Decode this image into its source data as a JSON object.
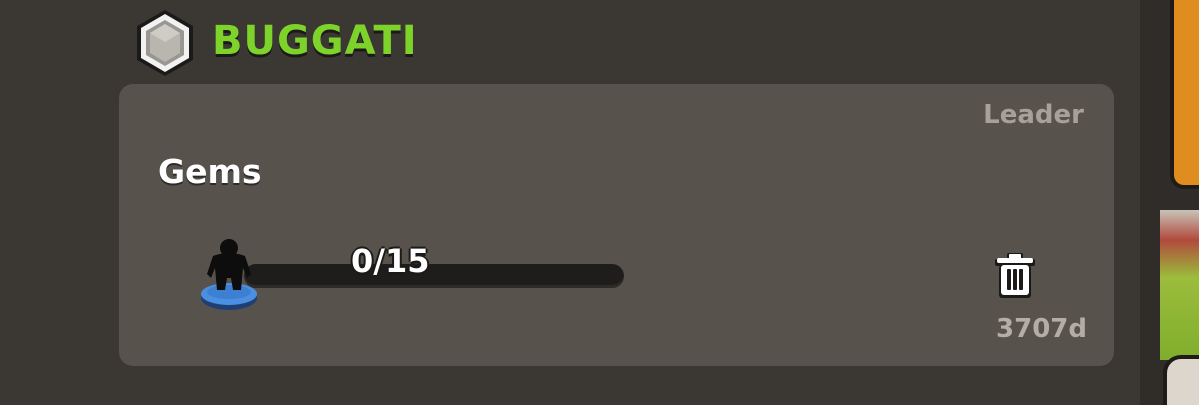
{
  "clan": {
    "name": "BUGGATI",
    "badge_icon": "gray-hexagon-badge-icon"
  },
  "member": {
    "role": "Leader",
    "name": "Gems",
    "donation_progress": {
      "current": 0,
      "total": 15,
      "text": "0/15",
      "icon": "troop-silhouette-icon"
    },
    "delete_icon": "trash-icon",
    "time_label": "3707d"
  },
  "colors": {
    "clan_name": "#7ed32a",
    "card_bg": "#58524d",
    "background": "#3b3834",
    "progress_fill": "#8fd03a",
    "troop_base": "#3d7fd1"
  }
}
